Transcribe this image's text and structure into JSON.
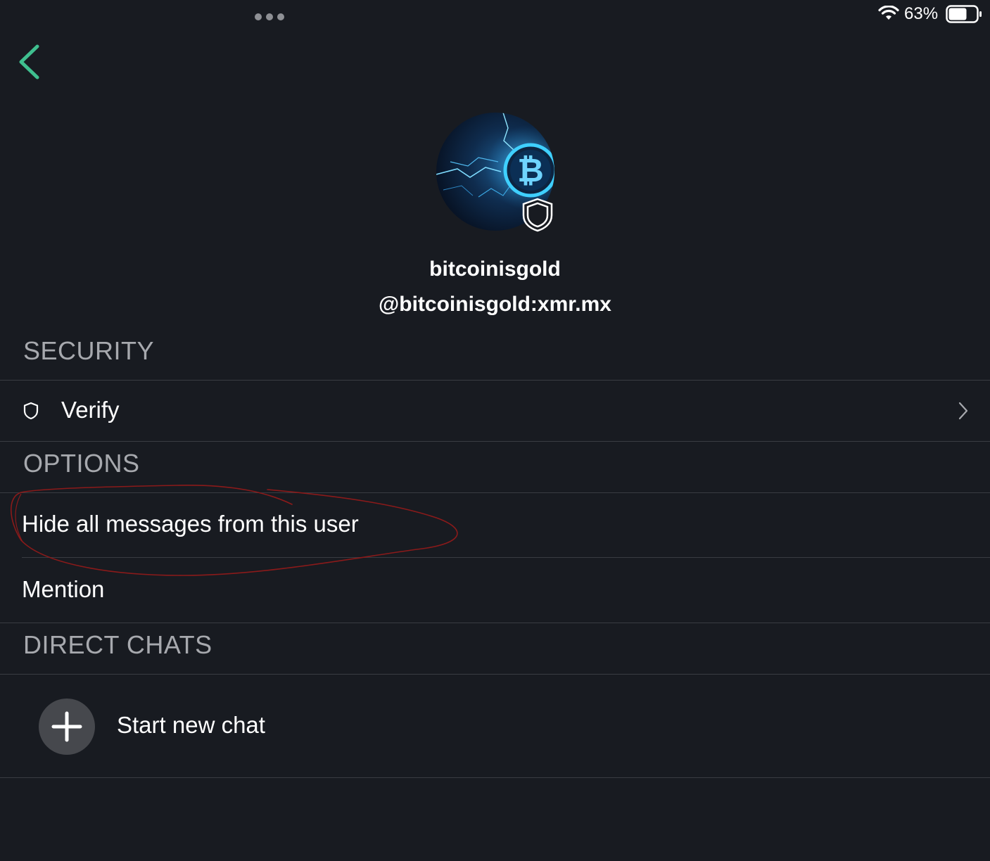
{
  "status_bar": {
    "battery_percent": "63%",
    "battery_level": 0.63,
    "wifi_icon": "wifi-icon",
    "battery_icon": "battery-icon"
  },
  "nav": {
    "back_icon": "chevron-left-icon",
    "accent_color": "#3fbf8f"
  },
  "profile": {
    "display_name": "bitcoinisgold",
    "user_id": "@bitcoinisgold:xmr.mx",
    "avatar_icon": "bitcoin-lightning-avatar",
    "badge_icon": "shield-icon"
  },
  "sections": {
    "security": {
      "header": "SECURITY",
      "verify_label": "Verify"
    },
    "options": {
      "header": "OPTIONS",
      "hide_label": "Hide all messages from this user",
      "mention_label": "Mention"
    },
    "direct_chats": {
      "header": "DIRECT CHATS",
      "start_new_chat_label": "Start new chat"
    }
  },
  "colors": {
    "background": "#181b21",
    "divider": "#393c42",
    "section_header": "#a7a9ae",
    "annotation": "#8b1a1a"
  }
}
